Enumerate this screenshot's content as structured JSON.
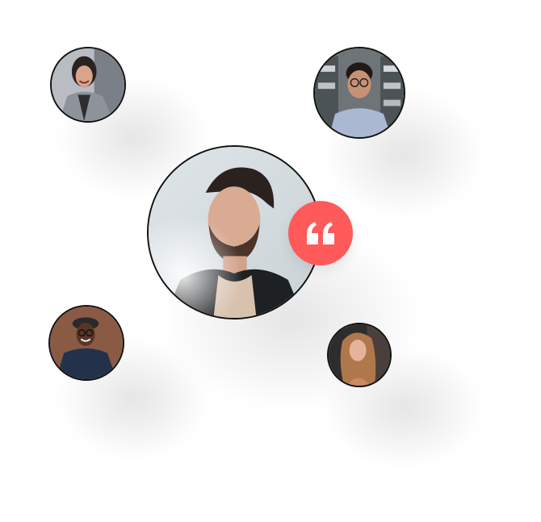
{
  "colors": {
    "accent": "#ff5a5a",
    "border": "#111111",
    "background": "#ffffff"
  },
  "icons": {
    "quote": "quote-icon"
  },
  "avatars": [
    {
      "name": "avatar-center",
      "icon": "person-portrait"
    },
    {
      "name": "avatar-top-left",
      "icon": "person-portrait"
    },
    {
      "name": "avatar-top-right",
      "icon": "person-portrait"
    },
    {
      "name": "avatar-bottom-left",
      "icon": "person-portrait"
    },
    {
      "name": "avatar-bottom-right",
      "icon": "person-portrait"
    }
  ]
}
